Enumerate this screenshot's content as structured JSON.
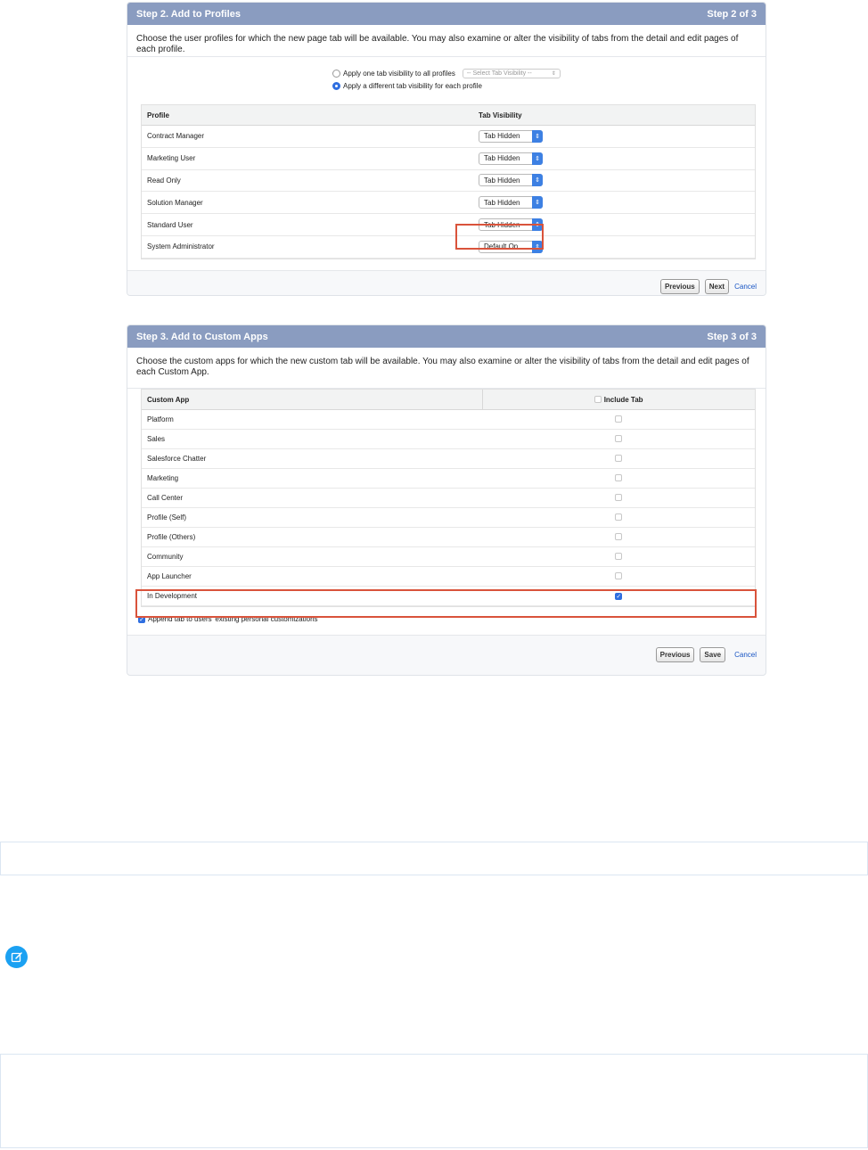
{
  "step2": {
    "title": "Step 2. Add to Profiles",
    "step_label": "Step 2 of 3",
    "description": "Choose the user profiles for which the new page tab will be available. You may also examine or alter the visibility of tabs from the detail and edit pages of each profile.",
    "radio_all_label": "Apply one tab visibility to all profiles",
    "radio_each_label": "Apply a different tab visibility for each profile",
    "select_all_placeholder": "-- Select Tab Visibility --",
    "columns": [
      "Profile",
      "Tab Visibility"
    ],
    "rows": [
      {
        "profile": "Contract Manager",
        "visibility": "Tab Hidden"
      },
      {
        "profile": "Marketing User",
        "visibility": "Tab Hidden"
      },
      {
        "profile": "Read Only",
        "visibility": "Tab Hidden"
      },
      {
        "profile": "Solution Manager",
        "visibility": "Tab Hidden"
      },
      {
        "profile": "Standard User",
        "visibility": "Tab Hidden"
      },
      {
        "profile": "System Administrator",
        "visibility": "Default On"
      }
    ],
    "buttons": {
      "previous": "Previous",
      "next": "Next",
      "cancel": "Cancel"
    }
  },
  "step3": {
    "title": "Step 3. Add to Custom Apps",
    "step_label": "Step 3 of 3",
    "description": "Choose the custom apps for which the new custom tab will be available. You may also examine or alter the visibility of tabs from the detail and edit pages of each Custom App.",
    "columns": [
      "Custom App",
      "Include Tab"
    ],
    "apps": [
      {
        "name": "Platform",
        "checked": false
      },
      {
        "name": "Sales",
        "checked": false
      },
      {
        "name": "Salesforce Chatter",
        "checked": false
      },
      {
        "name": "Marketing",
        "checked": false
      },
      {
        "name": "Call Center",
        "checked": false
      },
      {
        "name": "Profile (Self)",
        "checked": false
      },
      {
        "name": "Profile (Others)",
        "checked": false
      },
      {
        "name": "Community",
        "checked": false
      },
      {
        "name": "App Launcher",
        "checked": false
      },
      {
        "name": "In Development",
        "checked": true
      }
    ],
    "append_label": "Append tab to users' existing personal customizations",
    "buttons": {
      "previous": "Previous",
      "save": "Save",
      "cancel": "Cancel"
    }
  },
  "colors": {
    "header": "#8a9cc0",
    "highlight": "#d9533b",
    "accent": "#2f6fe0",
    "note_icon": "#1ba1f2"
  }
}
